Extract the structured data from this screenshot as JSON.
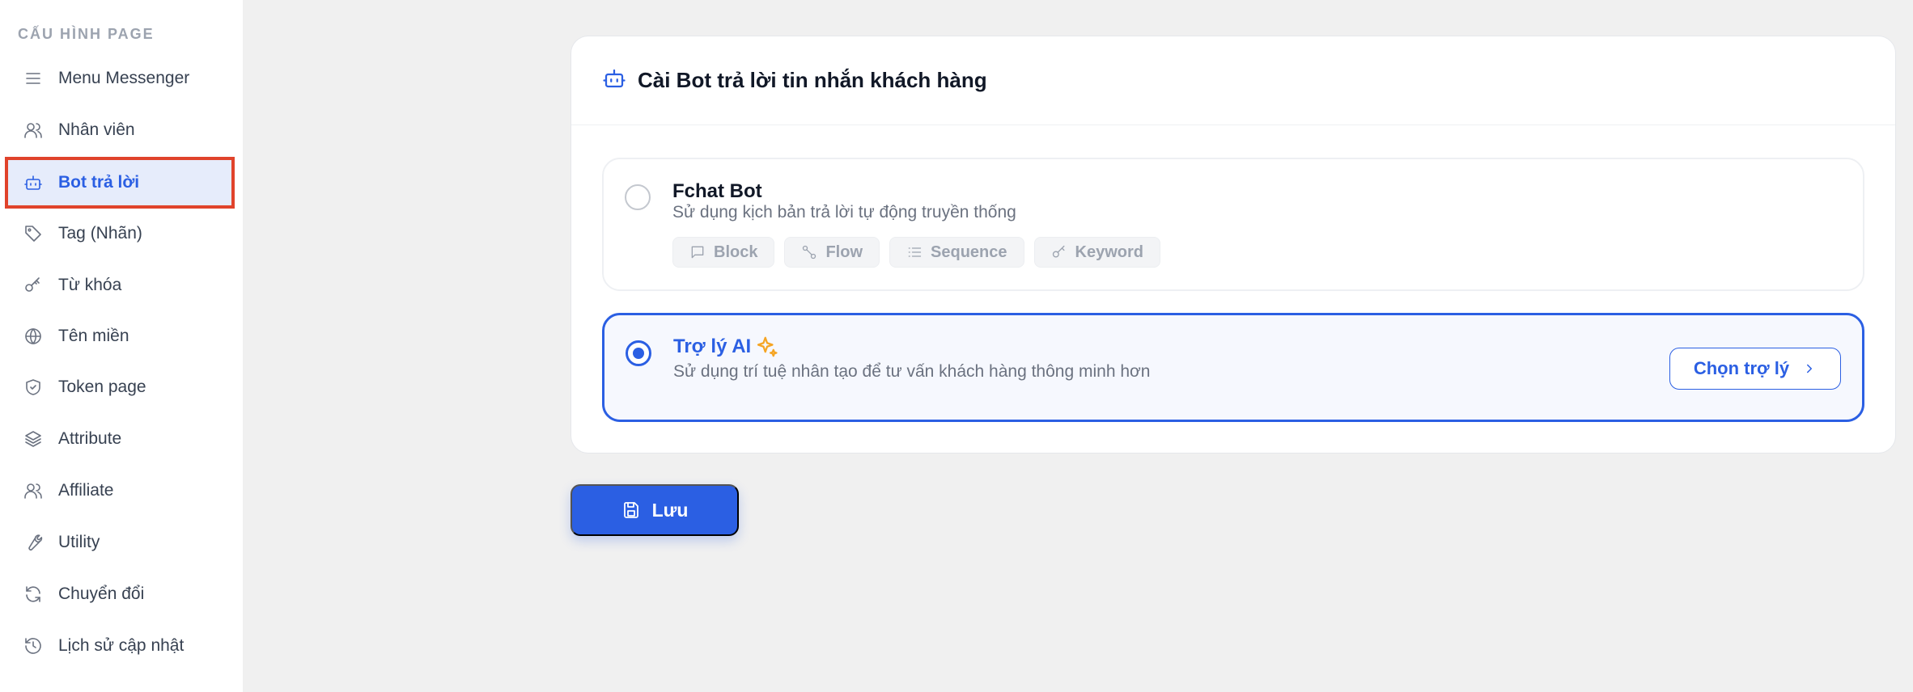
{
  "sidebar": {
    "heading": "CẤU HÌNH PAGE",
    "items": [
      {
        "label": "Menu Messenger",
        "icon": "menu-icon"
      },
      {
        "label": "Nhân viên",
        "icon": "users-icon"
      },
      {
        "label": "Bot trả lời",
        "icon": "bot-icon",
        "active": true
      },
      {
        "label": "Tag (Nhãn)",
        "icon": "tag-icon"
      },
      {
        "label": "Từ khóa",
        "icon": "key-icon"
      },
      {
        "label": "Tên miền",
        "icon": "globe-icon"
      },
      {
        "label": "Token page",
        "icon": "shield-icon"
      },
      {
        "label": "Attribute",
        "icon": "layers-icon"
      },
      {
        "label": "Affiliate",
        "icon": "users-icon"
      },
      {
        "label": "Utility",
        "icon": "wrench-icon"
      },
      {
        "label": "Chuyển đổi",
        "icon": "refresh-icon"
      },
      {
        "label": "Lịch sử cập nhật",
        "icon": "history-icon"
      }
    ]
  },
  "card": {
    "title": "Cài Bot trả lời tin nhắn khách hàng",
    "icon": "bot-icon"
  },
  "options": {
    "fchat": {
      "title": "Fchat Bot",
      "description": "Sử dụng kịch bản trả lời tự động truyền thống",
      "selected": false,
      "chips": [
        {
          "label": "Block",
          "icon": "message-square-icon"
        },
        {
          "label": "Flow",
          "icon": "flow-icon"
        },
        {
          "label": "Sequence",
          "icon": "list-icon"
        },
        {
          "label": "Keyword",
          "icon": "key-icon"
        }
      ]
    },
    "ai": {
      "title": "Trợ lý AI",
      "description": "Sử dụng trí tuệ nhân tạo để tư vấn khách hàng thông minh hơn",
      "selected": true,
      "button_label": "Chọn trợ lý"
    }
  },
  "save_button": {
    "label": "Lưu"
  },
  "colors": {
    "accent": "#2b5fe3",
    "active_bg": "#e6ecfb",
    "highlight_border": "#e0432b",
    "sparkle": "#f5a524",
    "page_bg": "#f0f0f0"
  }
}
